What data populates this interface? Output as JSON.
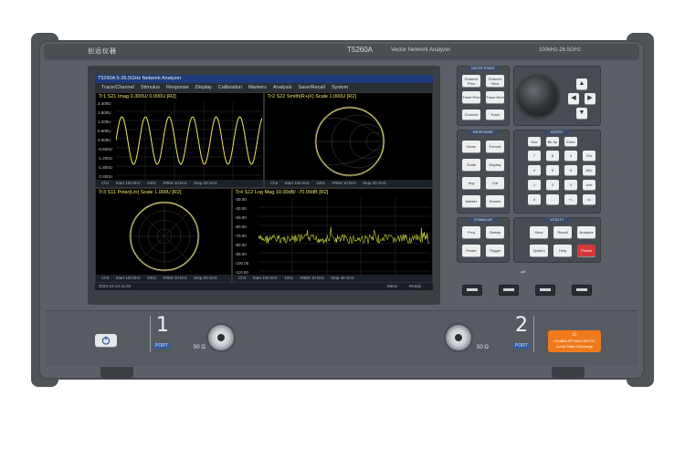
{
  "device": {
    "brand": "创远仪器",
    "model": "T5260A",
    "product": "Vector Network Analyzer",
    "range": "100kHz-26.5GHz"
  },
  "screen": {
    "title_bar": "T5260A 5-26.5GHz Network Analyzer",
    "menu": [
      "Trace/Channel",
      "Stimulus",
      "Response",
      "Display",
      "Calibration",
      "Markers",
      "Analysis",
      "Save/Recall",
      "System"
    ],
    "panes": [
      {
        "title": "Tr1 S21 Imag 0.300U/ 0.000U   [R2]",
        "yticks": [
          "2.400U",
          "1.800U",
          "1.200U",
          "0.600U",
          "0.000U",
          "-0.600U",
          "-1.200U",
          "-1.800U",
          "-2.400U"
        ],
        "foot": [
          "Ch1",
          "Start 100 kHz",
          "1001",
          "IFBW 10 kHz",
          "Stop 20 GHz"
        ]
      },
      {
        "title": "Tr2 S22 Smith(R+jX) Scale 1.000U   [R2]",
        "foot": [
          "Ch2",
          "Start 100 kHz",
          "1001",
          "IFBW 10 kHz",
          "Stop 20 GHz"
        ]
      },
      {
        "title": "Tr3 S11 Polar(Lin) Scale 1.000U   [R2]",
        "foot": [
          "Ch3",
          "Start 100 kHz",
          "1001",
          "IFBW 10 kHz",
          "Stop 20 GHz"
        ]
      },
      {
        "title": "Tr4 S12 Log Mag 10.00dB/ -70.00dB   [R2]",
        "yticks": [
          "-30.00",
          "-40.00",
          "-50.00",
          "-60.00",
          "-70.00",
          "-80.00",
          "-90.00",
          "-100.00",
          "-110.00"
        ],
        "foot": [
          "Ch4",
          "Start 100 kHz",
          "1001",
          "IFBW 10 kHz",
          "Stop 40 GHz"
        ]
      }
    ],
    "status": [
      "2020-10-14 11:50",
      "Meas",
      "Ready"
    ]
  },
  "panels": {
    "instr_state": {
      "tag": "INSTR STATE",
      "keys": [
        "Channel Prev",
        "Channel Next",
        "Trace Prev",
        "Trace Next",
        "Channel",
        "Trace"
      ]
    },
    "response": {
      "tag": "RESPONSE",
      "keys": [
        "Meas",
        "Format",
        "Scale",
        "Display",
        "Avg",
        "Cal",
        "Marker",
        "Search"
      ]
    },
    "entry": {
      "tag": "ENTRY",
      "keys": [
        "Esc",
        "Bk Sp",
        "Enter",
        "7",
        "8",
        "9",
        "G/n",
        "4",
        "5",
        "6",
        "M/u",
        "1",
        "2",
        "3",
        "k/m",
        "0",
        ".",
        "+/-",
        "x1"
      ]
    },
    "stimulus": {
      "tag": "STIMULUS",
      "keys": [
        "Freq",
        "Sweep",
        "Power",
        "Trigger"
      ]
    },
    "utility": {
      "tag": "UTILITY",
      "keys": [
        "Save",
        "Recall",
        "Analysis",
        "System",
        "Help",
        "Preset"
      ]
    }
  },
  "ports": [
    {
      "number": "1",
      "label": "PORT",
      "impedance": "50 Ω"
    },
    {
      "number": "2",
      "label": "PORT",
      "impedance": "50 Ω"
    }
  ],
  "warning": {
    "text": "+20dBm RF MAX 35V DC Avoid Static Discharge"
  },
  "colors": {
    "trace_yellow": "#f2e86a",
    "trace_green": "#c8d63a",
    "screen_bg": "#000000",
    "title_blue": "#1f3a78",
    "warning_orange": "#f07a1a",
    "preset_red": "#d23a3a",
    "body_gray": "#5b6066"
  }
}
